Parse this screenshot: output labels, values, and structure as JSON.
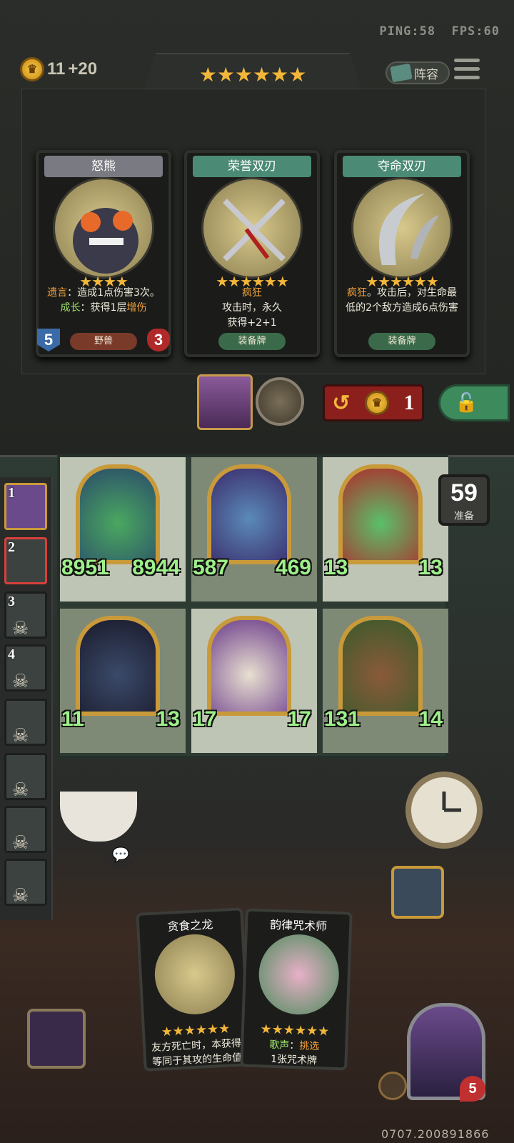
{
  "status": {
    "ping": "PING:58",
    "fps": "FPS:60"
  },
  "gold": {
    "amount": "11",
    "income": "+20"
  },
  "tier_stars": "★★★★★★",
  "lineup_label": "阵容",
  "shop": [
    {
      "name": "怒熊",
      "stars": "★★★★",
      "desc_html": "<span class='hl'>遗言</span>：造成1点伤害3次。<span class='gn'>成长</span>：获得1层<span class='hl'>增伤</span>",
      "tag": "野兽",
      "attack": "5",
      "health": "3",
      "type": "unit",
      "tag_color": "#7a3a2a"
    },
    {
      "name": "荣誉双刃",
      "stars": "★★★★★★",
      "desc_html": "<span class='hl'>疯狂</span><br>攻击时，永久<br>获得+2+1",
      "tag": "装备牌",
      "type": "equip",
      "tag_color": "#3a6a4a"
    },
    {
      "name": "夺命双刃",
      "stars": "★★★★★★",
      "desc_html": "<span class='hl'>疯狂</span>。攻击后，对生命最低的2个敌方造成6点伤害",
      "tag": "装备牌",
      "type": "equip",
      "tag_color": "#3a6a4a"
    }
  ],
  "refresh_cost": "1",
  "timer": {
    "value": "59",
    "label": "准备"
  },
  "board": [
    {
      "atk": "8951",
      "hp": "8944",
      "name": "dragon-green"
    },
    {
      "atk": "587",
      "hp": "469",
      "name": "dragon-blue"
    },
    {
      "atk": "13",
      "hp": "13",
      "name": "frog-apple"
    },
    {
      "atk": "11",
      "hp": "13",
      "name": "dragon-dark"
    },
    {
      "atk": "17",
      "hp": "17",
      "name": "dragon-white"
    },
    {
      "atk": "131",
      "hp": "14",
      "name": "wolf-hunter"
    }
  ],
  "roster": [
    "1",
    "2",
    "3",
    "4",
    "",
    "",
    "",
    ""
  ],
  "hand": [
    {
      "name": "贪食之龙",
      "stars": "★★★★★★",
      "desc": "友方死亡时，本获得等同于其攻的生命值"
    },
    {
      "name": "韵律咒术师",
      "stars": "★★★★★★",
      "desc_html": "<span class='gn'>歌声</span>：<span class='hl'>挑选</span><br>1张咒术牌"
    }
  ],
  "hero_hp": "5",
  "build_id": "0707.200891866",
  "colors": {
    "gold": "#f2b63a",
    "stat_green": "#9ef08a",
    "refresh_red": "#8a1f1c",
    "lock_green": "#3d8a5c"
  }
}
